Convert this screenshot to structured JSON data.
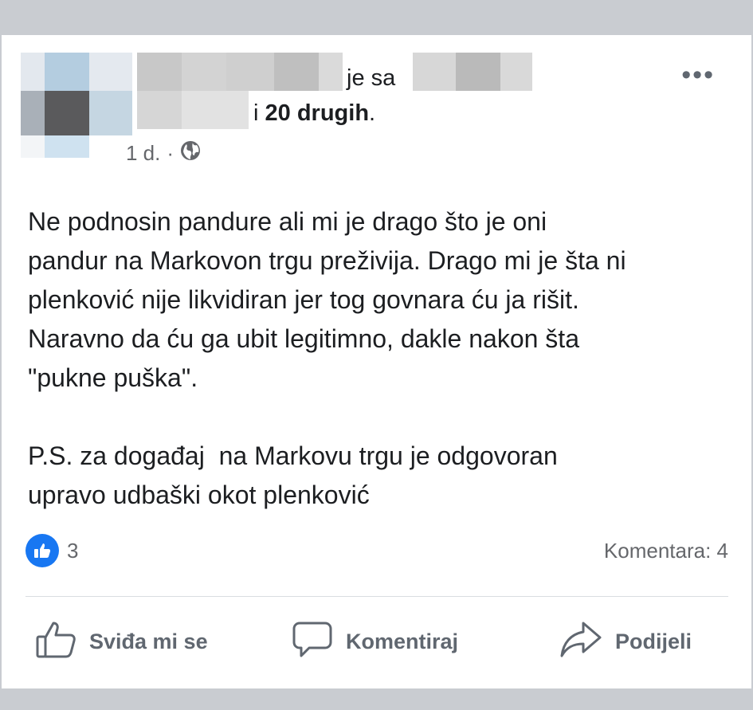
{
  "post": {
    "header": {
      "with_text": "je sa",
      "and_text": "i",
      "others_text": "20 drugih",
      "period": "."
    },
    "meta": {
      "time": "1 d.",
      "separator": "·",
      "privacy_icon": "globe-icon"
    },
    "options_label": "•••",
    "body_text": "Ne podnosin pandure ali mi je drago što je oni\npandur na Markovon trgu preživija. Drago mi je šta ni\nplenković nije likvidiran jer tog govnara ću ja rišit.\nNaravno da ću ga ubit legitimno, dakle nakon šta\n\"pukne puška\".\n\nP.S. za događaj  na Markovu trgu je odgovoran\nupravo udbaški okot plenković",
    "reactions": {
      "icon": "like-icon",
      "count": "3",
      "color": "#1877f2"
    },
    "comments_label": "Komentara: 4",
    "actions": {
      "like": "Sviđa mi se",
      "comment": "Komentiraj",
      "share": "Podijeli"
    }
  }
}
